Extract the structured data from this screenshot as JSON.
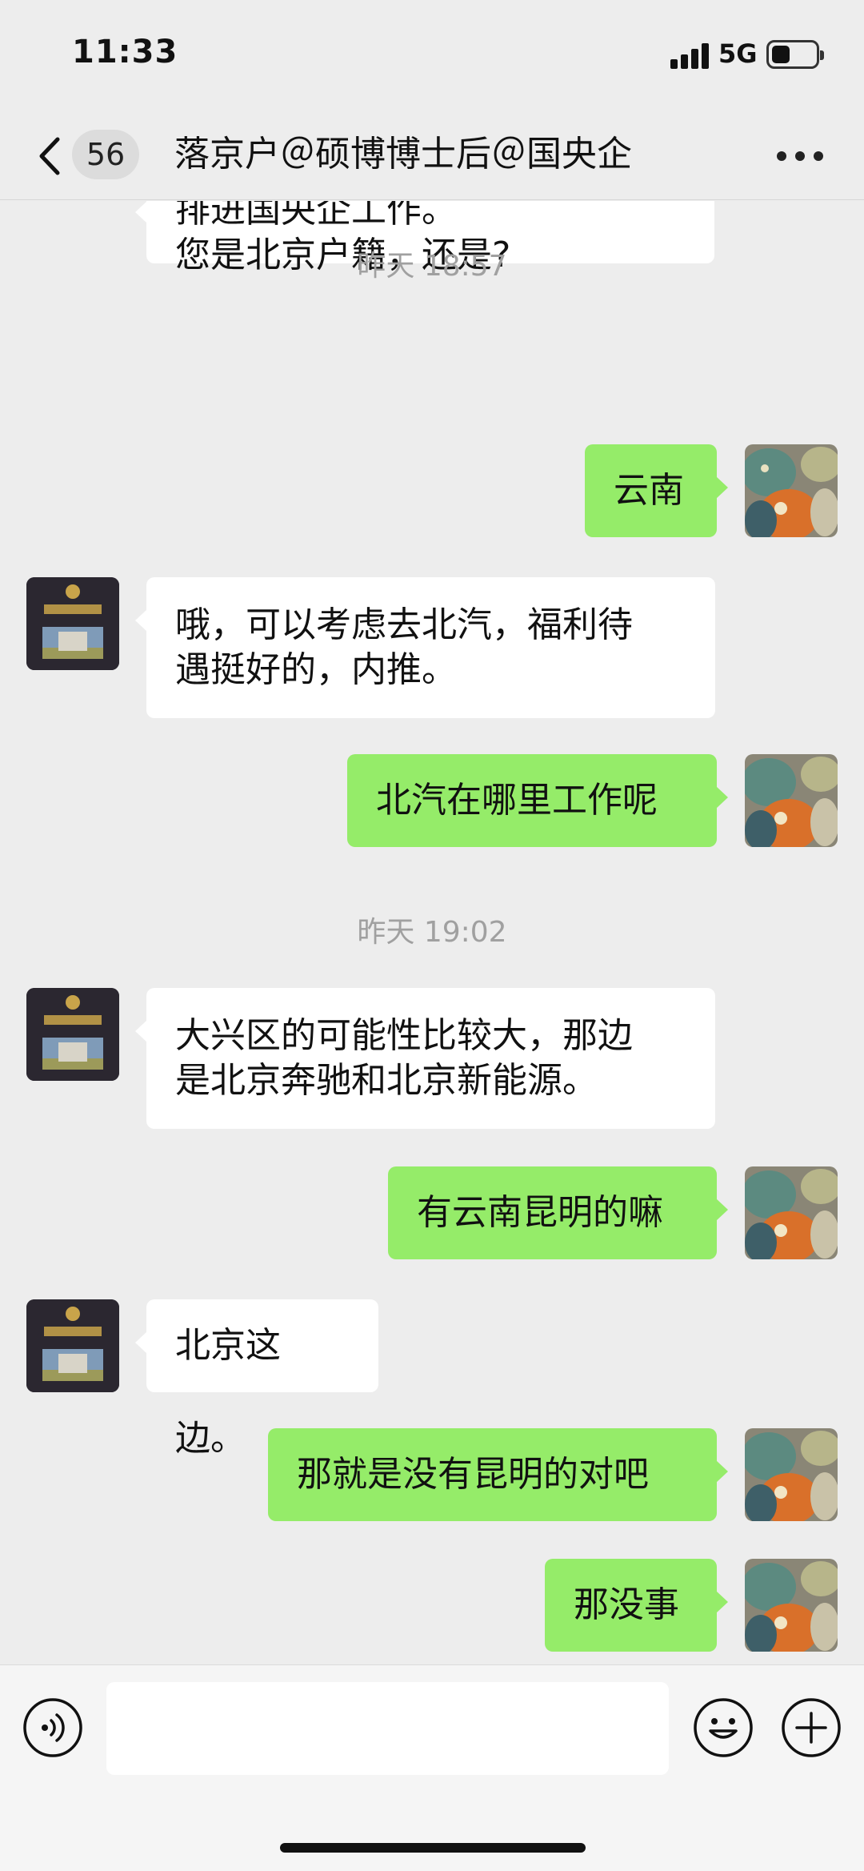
{
  "status_bar": {
    "time": "11:33",
    "network": "5G",
    "battery_level_fraction": 0.4
  },
  "nav": {
    "unread_count": "56",
    "title": "落京户＠硕博博士后＠国央企",
    "back_icon": "chevron-left-icon",
    "more_icon": "more-dots-icon"
  },
  "messages": [
    {
      "side": "left",
      "lines": [
        "排进国央企工作。",
        "您是北京户籍，还是?"
      ]
    },
    {
      "type": "time",
      "text": "昨天 18:57"
    },
    {
      "side": "right",
      "lines": [
        "云南"
      ]
    },
    {
      "side": "left",
      "lines": [
        "哦，可以考虑去北汽，福利待",
        "遇挺好的，内推。"
      ]
    },
    {
      "side": "right",
      "lines": [
        "北汽在哪里工作呢"
      ]
    },
    {
      "type": "time",
      "text": "昨天 19:02"
    },
    {
      "side": "left",
      "lines": [
        "大兴区的可能性比较大，那边",
        "是北京奔驰和北京新能源。"
      ]
    },
    {
      "side": "right",
      "lines": [
        "有云南昆明的嘛"
      ]
    },
    {
      "side": "left",
      "lines": [
        "北京这边。"
      ]
    },
    {
      "side": "right",
      "lines": [
        "那就是没有昆明的对吧"
      ]
    },
    {
      "side": "right",
      "lines": [
        "那没事"
      ]
    }
  ],
  "input_bar": {
    "voice_icon": "voice-icon",
    "text_value": "",
    "emoji_icon": "emoji-icon",
    "plus_icon": "plus-icon"
  },
  "colors": {
    "background": "#ededed",
    "outgoing_bubble": "#95ec69",
    "incoming_bubble": "#ffffff",
    "timestamp": "#a0a0a0"
  }
}
